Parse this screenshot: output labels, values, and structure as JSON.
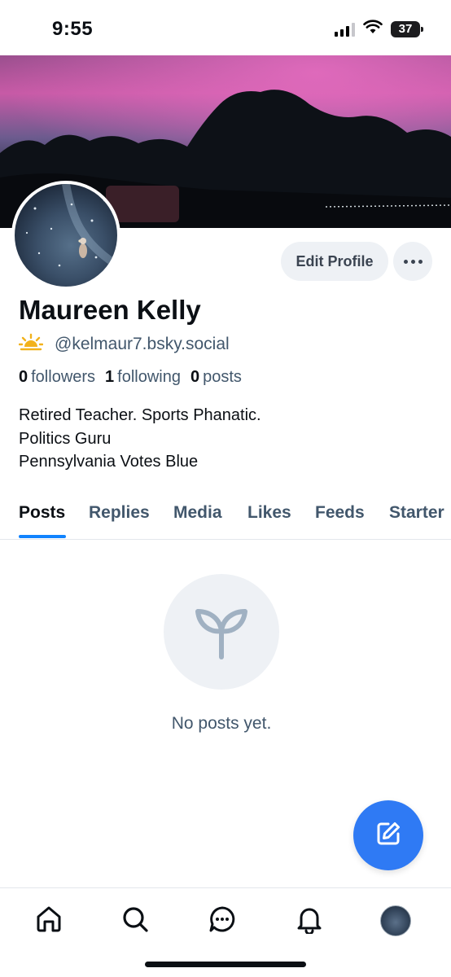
{
  "status_bar": {
    "time": "9:55",
    "battery": "37",
    "icons": [
      "signal-icon",
      "wifi-icon",
      "battery-icon"
    ]
  },
  "profile": {
    "display_name": "Maureen Kelly",
    "handle": "@kelmaur7.bsky.social",
    "handle_badge_icon": "sunrise-icon",
    "stats": {
      "followers_count": "0",
      "followers_label": "followers",
      "following_count": "1",
      "following_label": "following",
      "posts_count": "0",
      "posts_label": "posts"
    },
    "bio_lines": [
      "Retired Teacher. Sports Phanatic.",
      "Politics Guru",
      "Pennsylvania Votes Blue"
    ]
  },
  "actions": {
    "edit_profile_label": "Edit Profile",
    "more_icon": "ellipsis-icon"
  },
  "tabs": [
    {
      "label": "Posts",
      "active": true
    },
    {
      "label": "Replies",
      "active": false
    },
    {
      "label": "Media",
      "active": false
    },
    {
      "label": "Likes",
      "active": false
    },
    {
      "label": "Feeds",
      "active": false
    },
    {
      "label": "Starter",
      "active": false
    }
  ],
  "empty_state": {
    "icon": "sprout-icon",
    "text": "No posts yet."
  },
  "fab": {
    "icon": "compose-icon"
  },
  "bottom_nav": [
    {
      "icon": "home-icon"
    },
    {
      "icon": "search-icon"
    },
    {
      "icon": "chat-icon"
    },
    {
      "icon": "bell-icon"
    },
    {
      "icon": "profile-avatar"
    }
  ],
  "colors": {
    "accent": "#1183fe",
    "fab": "#2f7af4",
    "muted_text": "#42576c",
    "button_bg": "#eef1f5"
  }
}
